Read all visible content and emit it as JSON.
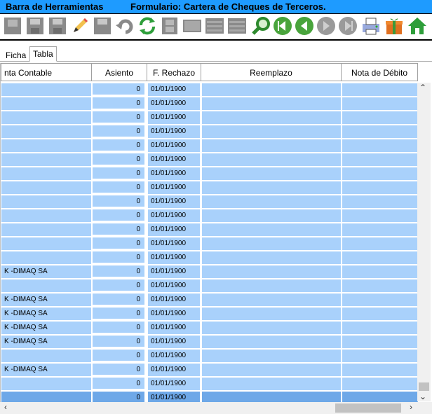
{
  "titlebar": {
    "left": "Barra de Herramientas",
    "right": "Formulario: Cartera de Cheques de Terceros."
  },
  "toolbar": {
    "icons": [
      "new-icon",
      "save-icon",
      "save-as-icon",
      "edit-icon",
      "disk-icon",
      "undo-icon",
      "refresh-icon",
      "film-icon",
      "blank-icon",
      "list-icon",
      "list-icon-2",
      "search-icon",
      "first-icon",
      "prev-icon",
      "next-icon",
      "last-icon",
      "print-icon",
      "gift-icon",
      "home-icon"
    ]
  },
  "tabs": [
    {
      "label": "Ficha"
    },
    {
      "label": "Tabla"
    }
  ],
  "columns": [
    {
      "label": "nta Contable"
    },
    {
      "label": "Asiento"
    },
    {
      "label": "F. Rechazo"
    },
    {
      "label": "Reemplazo"
    },
    {
      "label": "Nota de Débito"
    }
  ],
  "rows": [
    {
      "cuenta": "",
      "asiento": "0",
      "fecha": "01/01/1900"
    },
    {
      "cuenta": "",
      "asiento": "0",
      "fecha": "01/01/1900"
    },
    {
      "cuenta": "",
      "asiento": "0",
      "fecha": "01/01/1900"
    },
    {
      "cuenta": "",
      "asiento": "0",
      "fecha": "01/01/1900"
    },
    {
      "cuenta": "",
      "asiento": "0",
      "fecha": "01/01/1900"
    },
    {
      "cuenta": "",
      "asiento": "0",
      "fecha": "01/01/1900"
    },
    {
      "cuenta": "",
      "asiento": "0",
      "fecha": "01/01/1900"
    },
    {
      "cuenta": "",
      "asiento": "0",
      "fecha": "01/01/1900"
    },
    {
      "cuenta": "",
      "asiento": "0",
      "fecha": "01/01/1900"
    },
    {
      "cuenta": "",
      "asiento": "0",
      "fecha": "01/01/1900"
    },
    {
      "cuenta": "",
      "asiento": "0",
      "fecha": "01/01/1900"
    },
    {
      "cuenta": "",
      "asiento": "0",
      "fecha": "01/01/1900"
    },
    {
      "cuenta": "",
      "asiento": "0",
      "fecha": "01/01/1900"
    },
    {
      "cuenta": "K -DIMAQ SA",
      "asiento": "0",
      "fecha": "01/01/1900"
    },
    {
      "cuenta": "",
      "asiento": "0",
      "fecha": "01/01/1900"
    },
    {
      "cuenta": "K -DIMAQ SA",
      "asiento": "0",
      "fecha": "01/01/1900"
    },
    {
      "cuenta": "K -DIMAQ SA",
      "asiento": "0",
      "fecha": "01/01/1900"
    },
    {
      "cuenta": "K -DIMAQ SA",
      "asiento": "0",
      "fecha": "01/01/1900"
    },
    {
      "cuenta": "K -DIMAQ SA",
      "asiento": "0",
      "fecha": "01/01/1900"
    },
    {
      "cuenta": "",
      "asiento": "0",
      "fecha": "01/01/1900"
    },
    {
      "cuenta": "K -DIMAQ SA",
      "asiento": "0",
      "fecha": "01/01/1900"
    },
    {
      "cuenta": "",
      "asiento": "0",
      "fecha": "01/01/1900"
    },
    {
      "cuenta": "",
      "asiento": "0",
      "fecha": "01/01/1900"
    }
  ],
  "colors": {
    "titlebar": "#1e9bff",
    "row": "#a9d1fb",
    "selected_row": "#6ea8e8"
  }
}
